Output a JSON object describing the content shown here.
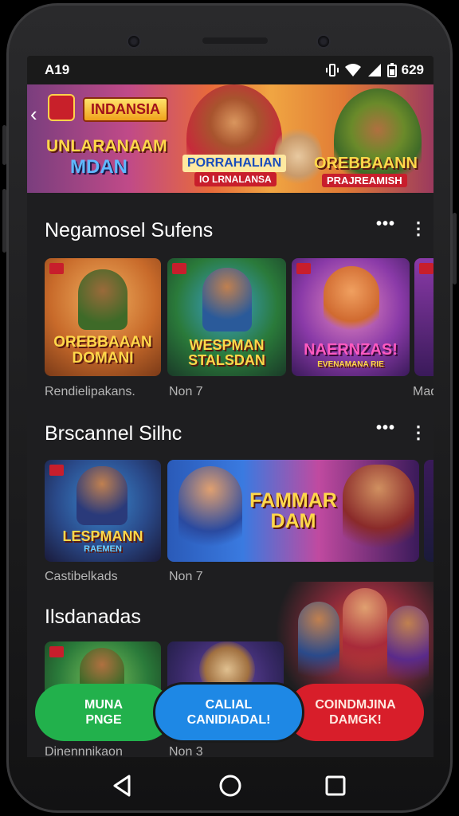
{
  "status_bar": {
    "time": "A19",
    "battery": "629"
  },
  "banner": {
    "brand": "INDANSIA",
    "line1": "UNLARANAAM",
    "line2": "MDAN",
    "center_title": "PORRAHALIAN",
    "center_sub": "IO LRNALANSA",
    "right_title": "OREBBAANN",
    "right_sub": "PRAJREAMISH"
  },
  "sections": [
    {
      "title": "Negamosel Sufens",
      "cards": [
        {
          "title": "OREBBAAAN DOMANI",
          "caption": "Rendielipakans."
        },
        {
          "title": "WESPMAN STALSDAN",
          "caption": "Non 7"
        },
        {
          "title": "NAERNZAS!",
          "sub": "EVENAMANA RIE",
          "caption": ""
        },
        {
          "title": "",
          "caption": "Mad"
        }
      ]
    },
    {
      "title": "Brscannel Silhc",
      "cards": [
        {
          "title": "LESPMANN",
          "sub": "RAEMEN",
          "caption": "Castibelkads"
        },
        {
          "title": "FAMMAR DAM",
          "caption": "Non 7"
        }
      ]
    },
    {
      "title": "Ilsdanadas",
      "cards": [
        {
          "title": "",
          "caption": "Dinennnikaon"
        },
        {
          "title": "",
          "caption": "Non 3"
        }
      ]
    }
  ],
  "buttons": {
    "green": {
      "line1": "MUNA",
      "line2": "PNGE"
    },
    "blue": {
      "line1": "CALIAL",
      "line2": "CANIDIADAL!"
    },
    "red": {
      "line1": "COINDMJINA",
      "line2": "DAMGK!"
    }
  },
  "colors": {
    "green": "#22b14c",
    "blue": "#1e88e5",
    "red": "#d81e2a"
  },
  "icons": [
    "back-icon",
    "more-horizontal-icon",
    "more-vertical-icon",
    "nav-back-icon",
    "nav-home-icon",
    "nav-recents-icon"
  ]
}
